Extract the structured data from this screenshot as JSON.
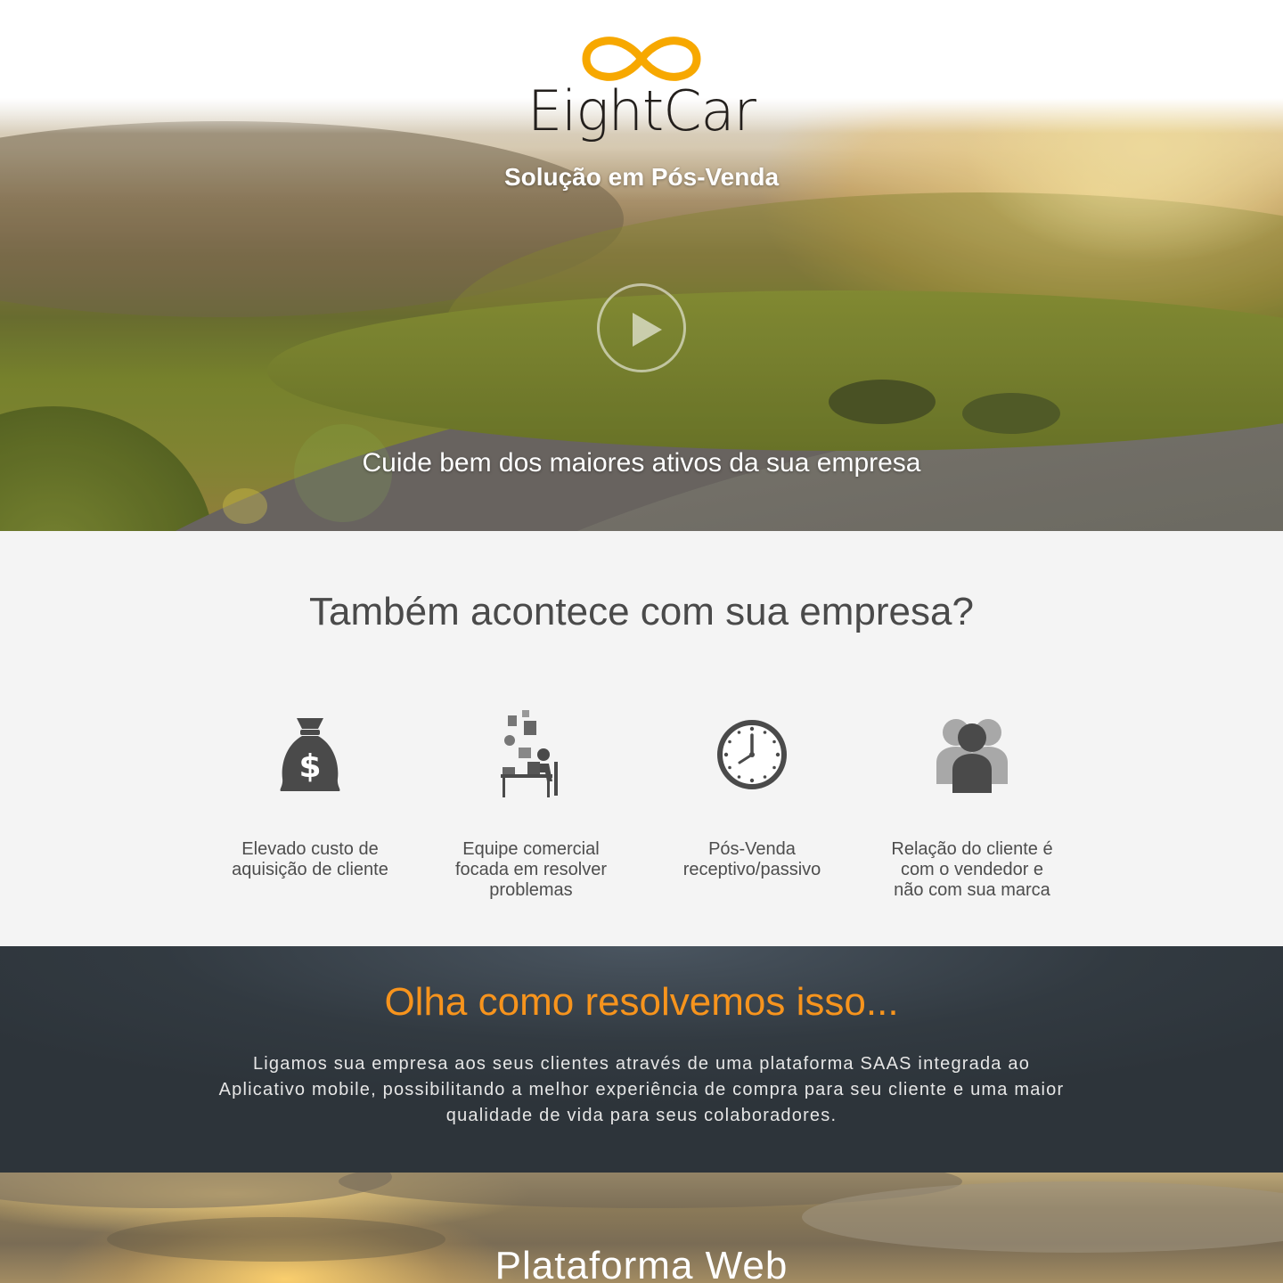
{
  "brand": {
    "name_part1": "Eight",
    "name_part2": "Car",
    "accent": "#f7a800"
  },
  "hero": {
    "tagline": "Solução em Pós-Venda",
    "caption": "Cuide bem dos maiores ativos da sua empresa"
  },
  "problems": {
    "title": "Também acontece com sua empresa?",
    "items": [
      {
        "icon": "money-bag-icon",
        "label": "Elevado custo de aquisição de cliente"
      },
      {
        "icon": "overworked-desk-icon",
        "label": "Equipe comercial focada em resolver problemas"
      },
      {
        "icon": "clock-icon",
        "label": "Pós-Venda receptivo/passivo"
      },
      {
        "icon": "people-icon",
        "label": "Relação do cliente é com o vendedor e não com sua marca"
      }
    ]
  },
  "solution": {
    "title": "Olha como resolvemos isso...",
    "text": "Ligamos sua empresa aos seus clientes através de uma plataforma SAAS integrada ao Aplicativo mobile, possibilitando a melhor experiência de compra para seu cliente e uma maior qualidade de vida para seus colaboradores.",
    "title_color": "#f7941d"
  },
  "platform": {
    "title": "Plataforma Web"
  }
}
